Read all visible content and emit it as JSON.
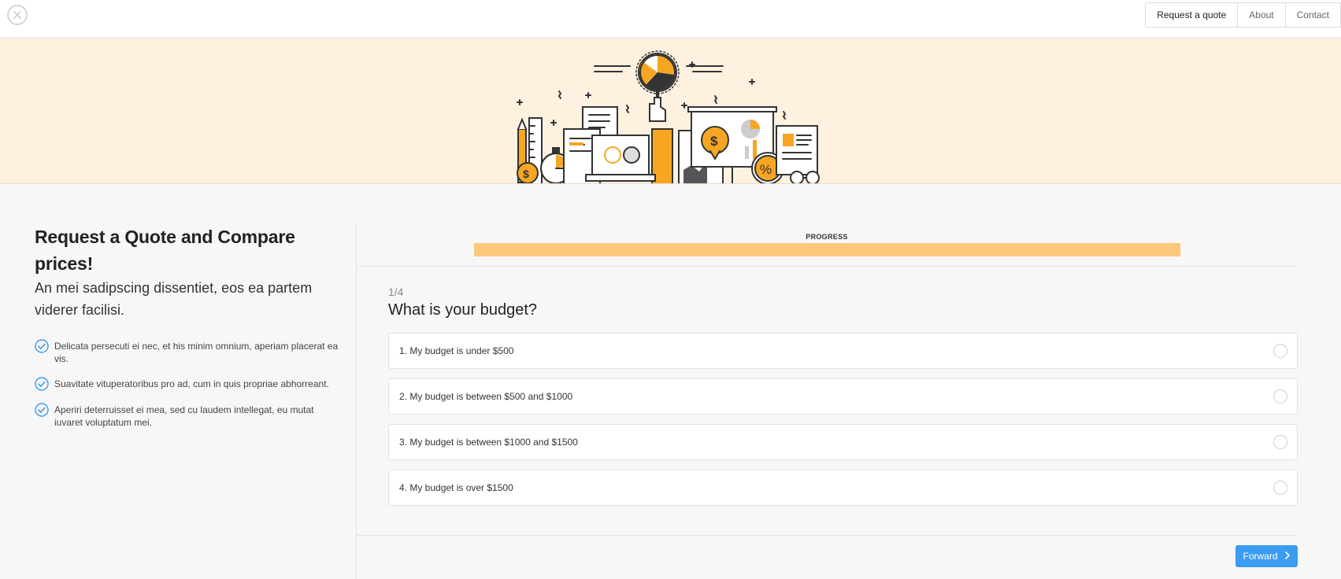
{
  "nav": {
    "items": [
      {
        "label": "Request a quote",
        "active": true
      },
      {
        "label": "About",
        "active": false
      },
      {
        "label": "Contact",
        "active": false
      }
    ]
  },
  "intro": {
    "title": "Request a Quote and Compare prices!",
    "lead": "An mei sadipscing dissentiet, eos ea partem viderer facilisi.",
    "features": [
      "Delicata persecuti ei nec, et his minim omnium, aperiam placerat ea vis.",
      "Suavitate vituperatoribus pro ad, cum in quis propriae abhorreant.",
      "Aperiri deterruisset ei mea, sed cu laudem intellegat, eu mutat iuvaret voluptatum mei."
    ]
  },
  "progress": {
    "label": "PROGRESS",
    "value_percent": 100
  },
  "question": {
    "step": "1/4",
    "title": "What is your budget?",
    "options": [
      "1. My budget is under $500",
      "2. My budget is between $500 and $1000",
      "3. My budget is between $1000 and $1500",
      "4. My budget is over $1500"
    ]
  },
  "actions": {
    "forward_label": "Forward"
  },
  "colors": {
    "accent_orange": "#f6a623",
    "hero_bg": "#fff1e0",
    "progress_fill": "#fcc97a",
    "button_blue": "#3b9cf2",
    "check_blue": "#3b9cf2"
  },
  "icons": {
    "close": "close-circle-icon",
    "check": "check-circle-icon",
    "forward": "chevron-right-icon"
  }
}
